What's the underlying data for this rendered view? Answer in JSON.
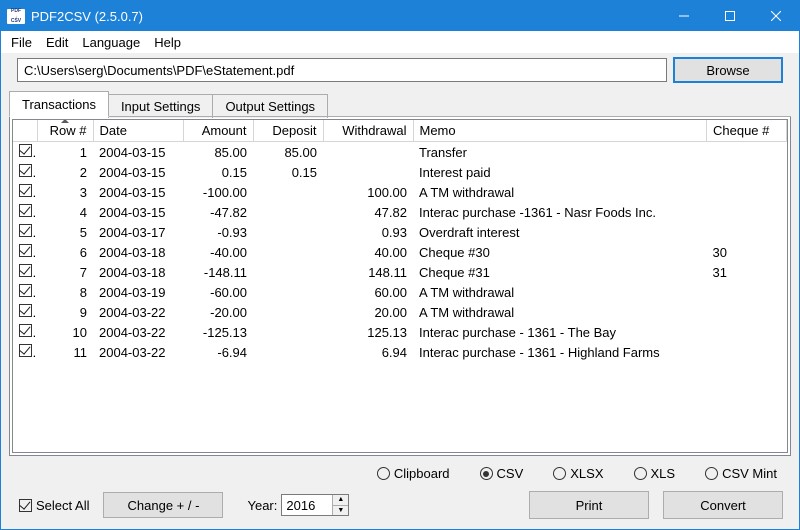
{
  "window": {
    "title": "PDF2CSV (2.5.0.7)",
    "icon_top": "PDF",
    "icon_bot": "CSV"
  },
  "menubar": {
    "file": "File",
    "edit": "Edit",
    "language": "Language",
    "help": "Help"
  },
  "path_input_value": "C:\\Users\\serg\\Documents\\PDF\\eStatement.pdf",
  "browse_label": "Browse",
  "tabs": {
    "transactions": "Transactions",
    "input_settings": "Input Settings",
    "output_settings": "Output Settings"
  },
  "columns": {
    "check": "",
    "row": "Row #",
    "date": "Date",
    "amount": "Amount",
    "deposit": "Deposit",
    "withdrawal": "Withdrawal",
    "memo": "Memo",
    "cheque": "Cheque #"
  },
  "rows": [
    {
      "checked": true,
      "row": "1",
      "date": "2004-03-15",
      "amount": "85.00",
      "deposit": "85.00",
      "withdrawal": "",
      "memo": "Transfer",
      "cheque": ""
    },
    {
      "checked": true,
      "row": "2",
      "date": "2004-03-15",
      "amount": "0.15",
      "deposit": "0.15",
      "withdrawal": "",
      "memo": "Interest paid",
      "cheque": ""
    },
    {
      "checked": true,
      "row": "3",
      "date": "2004-03-15",
      "amount": "-100.00",
      "deposit": "",
      "withdrawal": "100.00",
      "memo": "A TM withdrawal",
      "cheque": ""
    },
    {
      "checked": true,
      "row": "4",
      "date": "2004-03-15",
      "amount": "-47.82",
      "deposit": "",
      "withdrawal": "47.82",
      "memo": "Interac purchase -1361 - Nasr Foods Inc.",
      "cheque": ""
    },
    {
      "checked": true,
      "row": "5",
      "date": "2004-03-17",
      "amount": "-0.93",
      "deposit": "",
      "withdrawal": "0.93",
      "memo": "Overdraft interest",
      "cheque": ""
    },
    {
      "checked": true,
      "row": "6",
      "date": "2004-03-18",
      "amount": "-40.00",
      "deposit": "",
      "withdrawal": "40.00",
      "memo": "Cheque #30",
      "cheque": "30"
    },
    {
      "checked": true,
      "row": "7",
      "date": "2004-03-18",
      "amount": "-148.11",
      "deposit": "",
      "withdrawal": "148.11",
      "memo": "Cheque #31",
      "cheque": "31"
    },
    {
      "checked": true,
      "row": "8",
      "date": "2004-03-19",
      "amount": "-60.00",
      "deposit": "",
      "withdrawal": "60.00",
      "memo": "A TM withdrawal",
      "cheque": ""
    },
    {
      "checked": true,
      "row": "9",
      "date": "2004-03-22",
      "amount": "-20.00",
      "deposit": "",
      "withdrawal": "20.00",
      "memo": "A TM withdrawal",
      "cheque": ""
    },
    {
      "checked": true,
      "row": "10",
      "date": "2004-03-22",
      "amount": "-125.13",
      "deposit": "",
      "withdrawal": "125.13",
      "memo": "Interac purchase - 1361 - The Bay",
      "cheque": ""
    },
    {
      "checked": true,
      "row": "11",
      "date": "2004-03-22",
      "amount": "-6.94",
      "deposit": "",
      "withdrawal": "6.94",
      "memo": "Interac purchase - 1361 - Highland Farms",
      "cheque": ""
    }
  ],
  "export_options": {
    "clipboard": "Clipboard",
    "csv": "CSV",
    "xlsx": "XLSX",
    "xls": "XLS",
    "csv_mint": "CSV Mint",
    "selected": "csv"
  },
  "bottom": {
    "select_all": "Select All",
    "change_sign": "Change + / -",
    "year_label": "Year:",
    "year_value": "2016",
    "print": "Print",
    "convert": "Convert"
  }
}
